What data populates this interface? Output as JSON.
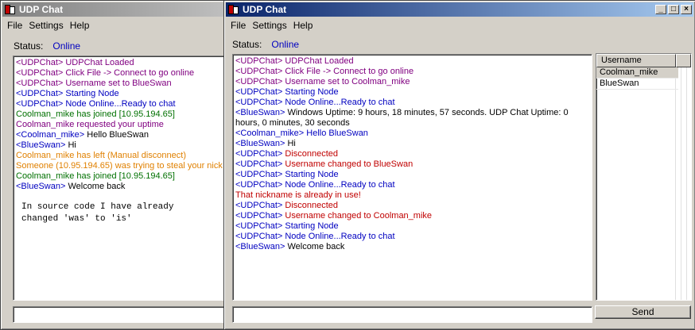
{
  "back_window": {
    "title": "UDP Chat",
    "menu": [
      "File",
      "Settings",
      "Help"
    ],
    "status_label": "Status:",
    "status_value": "Online",
    "messages": [
      {
        "text": "<UDPChat> UDPChat Loaded",
        "color": "#800080"
      },
      {
        "text": "<UDPChat> Click File -> Connect to go online",
        "color": "#800080"
      },
      {
        "text": "<UDPChat> Username set to BlueSwan",
        "color": "#800080"
      },
      {
        "text": "<UDPChat> Starting Node",
        "color": "#0000c0"
      },
      {
        "text": "<UDPChat> Node Online...Ready to chat",
        "color": "#0000c0"
      },
      {
        "text": "Coolman_mike has joined [10.95.194.65]",
        "color": "#007000"
      },
      {
        "text": "Coolman_mike requested your uptime",
        "color": "#800080"
      },
      {
        "text": "<Coolman_mike> Hello BlueSwan",
        "color": "#000000",
        "prefix": "<Coolman_mike>",
        "prefix_color": "#0000c0"
      },
      {
        "text": "<BlueSwan> Hi",
        "color": "#000000",
        "prefix": "<BlueSwan>",
        "prefix_color": "#0000c0"
      },
      {
        "text": "Coolman_mike has left (Manual disconnect)",
        "color": "#e08000"
      },
      {
        "text": "Someone (10.95.194.65) was trying to steal your nick",
        "color": "#e08000"
      },
      {
        "text": "Coolman_mike has joined [10.95.194.65]",
        "color": "#007000"
      },
      {
        "text": "<BlueSwan> Welcome back",
        "color": "#000000",
        "prefix": "<BlueSwan>",
        "prefix_color": "#0000c0"
      }
    ],
    "note": "In source code I have already\nchanged 'was' to 'is'",
    "input_value": ""
  },
  "front_window": {
    "title": "UDP Chat",
    "caption_buttons": [
      "_",
      "□",
      "×"
    ],
    "menu": [
      "File",
      "Settings",
      "Help"
    ],
    "status_label": "Status:",
    "status_value": "Online",
    "messages": [
      {
        "text": "<UDPChat> UDPChat Loaded",
        "color": "#800080"
      },
      {
        "text": "<UDPChat> Click File -> Connect to go online",
        "color": "#800080"
      },
      {
        "text": "<UDPChat> Username set to Coolman_mike",
        "color": "#800080"
      },
      {
        "text": "<UDPChat> Starting Node",
        "color": "#0000c0"
      },
      {
        "text": "<UDPChat> Node Online...Ready to chat",
        "color": "#0000c0"
      },
      {
        "text": "<BlueSwan> Windows Uptime: 9 hours, 18 minutes, 57 seconds. UDP Chat Uptime: 0 hours, 0 minutes, 30 seconds",
        "color": "#000000",
        "prefix": "<BlueSwan>",
        "prefix_color": "#0000c0"
      },
      {
        "text": "<Coolman_mike> Hello BlueSwan",
        "color": "#0000c0"
      },
      {
        "text": "<BlueSwan> Hi",
        "color": "#000000",
        "prefix": "<BlueSwan>",
        "prefix_color": "#0000c0"
      },
      {
        "text": "<UDPChat> Disconnected",
        "color": "#c00000",
        "prefix": "<UDPChat>",
        "prefix_color": "#0000c0"
      },
      {
        "text": "<UDPChat> Username changed to BlueSwan",
        "color": "#c00000",
        "prefix": "<UDPChat>",
        "prefix_color": "#0000c0"
      },
      {
        "text": "<UDPChat> Starting Node",
        "color": "#0000c0"
      },
      {
        "text": "<UDPChat> Node Online...Ready to chat",
        "color": "#0000c0"
      },
      {
        "text": "That nickname is already in use!",
        "color": "#c00000"
      },
      {
        "text": "<UDPChat> Disconnected",
        "color": "#c00000",
        "prefix": "<UDPChat>",
        "prefix_color": "#0000c0"
      },
      {
        "text": "<UDPChat> Username changed to Coolman_mike",
        "color": "#c00000",
        "prefix": "<UDPChat>",
        "prefix_color": "#0000c0"
      },
      {
        "text": "<UDPChat> Starting Node",
        "color": "#0000c0"
      },
      {
        "text": "<UDPChat> Node Online...Ready to chat",
        "color": "#0000c0"
      },
      {
        "text": "<BlueSwan> Welcome back",
        "color": "#000000",
        "prefix": "<BlueSwan>",
        "prefix_color": "#0000c0"
      }
    ],
    "users_header": "Username",
    "users": [
      "Coolman_mike",
      "BlueSwan"
    ],
    "input_value": "",
    "send_label": "Send"
  }
}
